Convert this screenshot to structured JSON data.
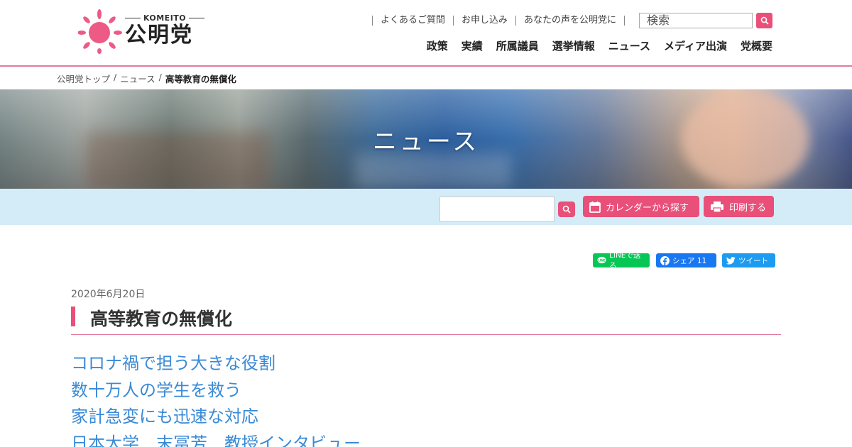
{
  "header": {
    "logo_en": "KOMEITO",
    "logo_jp": "公明党",
    "utility_links": [
      "よくあるご質問",
      "お申し込み",
      "あなたの声を公明党に"
    ],
    "search_placeholder": "検索",
    "nav": [
      "政策",
      "実績",
      "所属議員",
      "選挙情報",
      "ニュース",
      "メディア出演",
      "党概要"
    ]
  },
  "breadcrumb": [
    "公明党トップ",
    "/",
    "ニュース",
    "/",
    "高等教育の無償化"
  ],
  "hero": {
    "title": "ニュース"
  },
  "toolbar": {
    "calendar_label": "カレンダーから探す",
    "print_label": "印刷する"
  },
  "share": {
    "line": "LINEで送る",
    "facebook": "シェア 11",
    "twitter": "ツイート"
  },
  "article": {
    "date": "2020年6月20日",
    "title": "高等教育の無償化",
    "headlines": [
      "コロナ禍で担う大きな役割",
      "数十万人の学生を救う",
      "家計急変にも迅速な対応",
      "日本大学　末冨芳　教授インタビュー"
    ]
  },
  "colors": {
    "accent_pink": "#e8507a",
    "link_blue": "#3a8ad6",
    "toolbar_bg": "#d4ecf8",
    "line_green": "#06c755",
    "facebook_blue": "#1877f2",
    "twitter_blue": "#1d9bf0"
  },
  "icons": [
    "sun-logo-icon",
    "search-icon",
    "calendar-icon",
    "printer-icon",
    "line-icon",
    "facebook-icon",
    "twitter-icon"
  ]
}
